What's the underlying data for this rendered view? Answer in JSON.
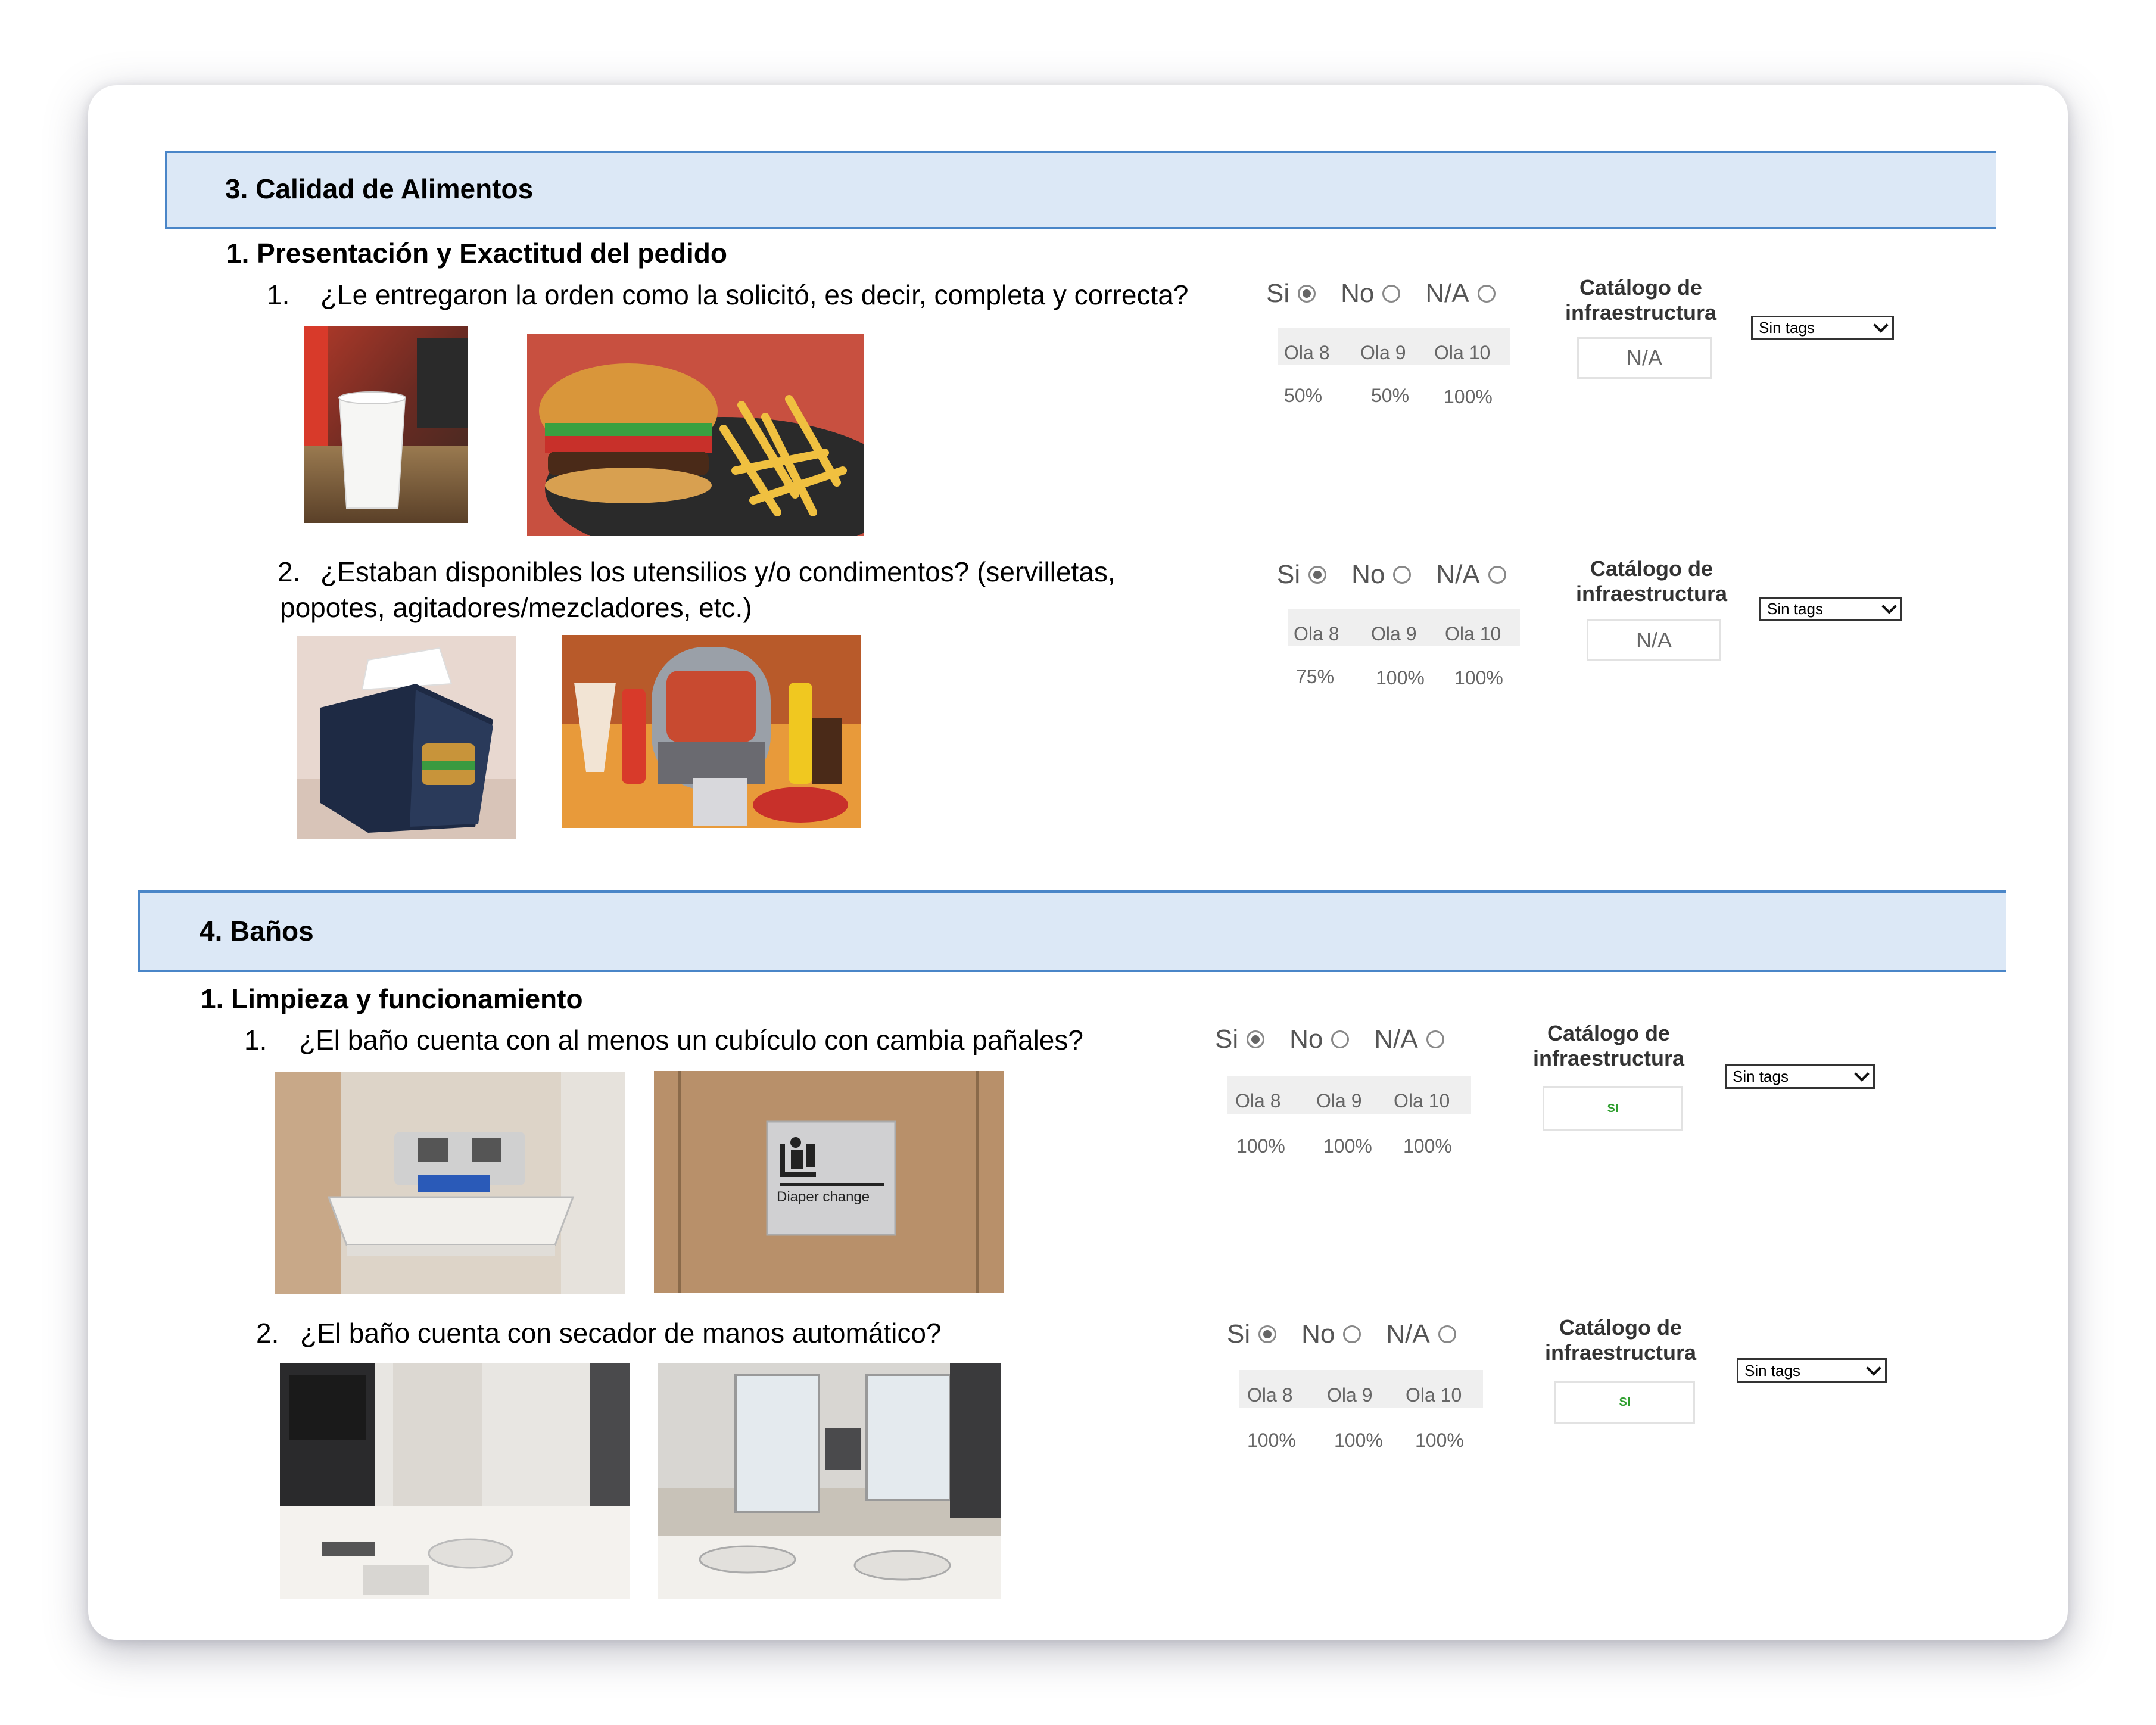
{
  "sections": [
    {
      "title": "3. Calidad de Alimentos",
      "subsection": "1.  Presentación y Exactitud del pedido",
      "questions": [
        {
          "number": "1.",
          "text": "¿Le entregaron la orden  como la solicitó, es decir, completa y correcta?",
          "options": [
            "Si",
            "No",
            "N/A"
          ],
          "selected": "Si",
          "waves": [
            "Ola 8",
            "Ola 9",
            "Ola 10"
          ],
          "values": [
            "50%",
            "50%",
            "100%"
          ],
          "catalog_label_1": "Catálogo de",
          "catalog_label_2": "infraestructura",
          "catalog_value": "N/A",
          "tags": "Sin tags"
        },
        {
          "number": "2.",
          "text": "¿Estaban disponibles los utensilios y/o condimentos? (servilletas, popotes, agitadores/mezcladores, etc.)",
          "options": [
            "Si",
            "No",
            "N/A"
          ],
          "selected": "Si",
          "waves": [
            "Ola 8",
            "Ola 9",
            "Ola 10"
          ],
          "values": [
            "75%",
            "100%",
            "100%"
          ],
          "catalog_label_1": "Catálogo de",
          "catalog_label_2": "infraestructura",
          "catalog_value": "N/A",
          "tags": "Sin tags"
        }
      ]
    },
    {
      "title": "4. Baños",
      "subsection": "1.  Limpieza y funcionamiento",
      "questions": [
        {
          "number": "1.",
          "text": "¿El baño cuenta con al menos un cubículo con cambia pañales?",
          "options": [
            "Si",
            "No",
            "N/A"
          ],
          "selected": "Si",
          "waves": [
            "Ola 8",
            "Ola 9",
            "Ola 10"
          ],
          "values": [
            "100%",
            "100%",
            "100%"
          ],
          "catalog_label_1": "Catálogo de",
          "catalog_label_2": "infraestructura",
          "catalog_value": "SI",
          "tags": "Sin tags",
          "sign_text": "Diaper change"
        },
        {
          "number": "2.",
          "text": "¿El baño cuenta con secador de manos automático?",
          "options": [
            "Si",
            "No",
            "N/A"
          ],
          "selected": "Si",
          "waves": [
            "Ola 8",
            "Ola 9",
            "Ola 10"
          ],
          "values": [
            "100%",
            "100%",
            "100%"
          ],
          "catalog_label_1": "Catálogo de",
          "catalog_label_2": "infraestructura",
          "catalog_value": "SI",
          "tags": "Sin tags"
        }
      ]
    }
  ],
  "colors": {
    "header_bg": "#dce8f6",
    "header_border": "#4a86c8",
    "catalog_green": "#2e9e2e"
  },
  "icons": [
    "radio-selected-icon",
    "radio-unselected-icon",
    "chevron-down-icon",
    "baby-changing-icon"
  ]
}
